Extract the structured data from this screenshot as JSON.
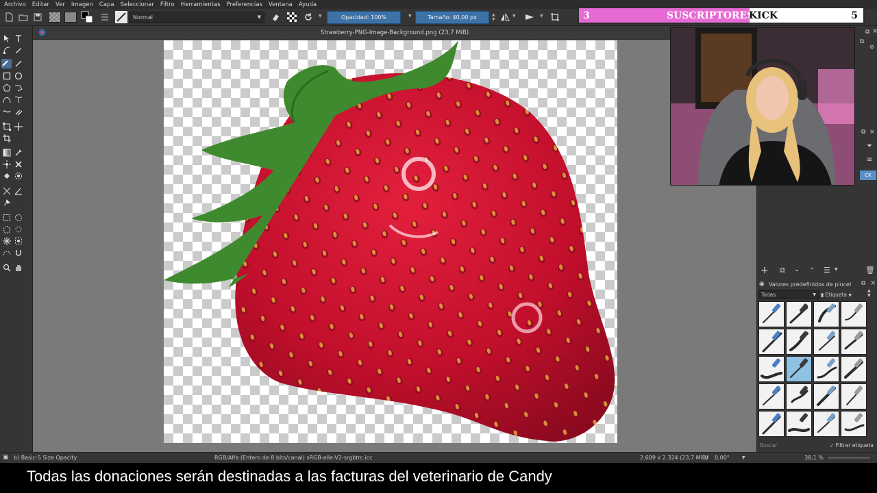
{
  "menu": [
    "Archivo",
    "Editar",
    "Ver",
    "Imagen",
    "Capa",
    "Seleccionar",
    "Filtro",
    "Herramientas",
    "Preferencias",
    "Ventana",
    "Ayuda"
  ],
  "toolbar": {
    "blend_mode": "Normal",
    "opacity_label": "Opacidad: 100%",
    "size_label": "Tamaño: 40,00 px",
    "opacity_value": 1.0
  },
  "sub_banner": {
    "left_count": "3",
    "text_a": "SUSCRIPTORES",
    "text_b": "KICK",
    "right_count": "5",
    "progress": 0.6,
    "fill_color": "#e66ad4"
  },
  "document": {
    "tab_title": "Strawberry-PNG-Image-Background.png (23,7 MiB)"
  },
  "right_panel": {
    "presets_title": "Valores predefinidos de pincel",
    "filter_value": "Todas",
    "tag_label": "Etiqueta",
    "search_placeholder": "Buscar",
    "filter_tag_label": "Filtrar etiqueta",
    "side_badge": "CK"
  },
  "statusbar": {
    "brush_preset": "b) Basic-5 Size Opacity",
    "color_info": "RGB/Alfa (Entero de 8 bits/canal)  sRGB-elle-V2-srgbtrc.icc",
    "dimensions": "2.609 x 2.324 (23,7 MiB)",
    "rotation": "0,00°",
    "zoom": "38,1 %"
  },
  "caption": "Todas las donaciones serán destinadas a las facturas del veterinario de Candy",
  "colors": {
    "panel_bg": "#353535",
    "canvas_bg": "#7a7a7a",
    "accent": "#3d72a8",
    "strawberry": "#c8102e",
    "leaf": "#3f8a2e"
  }
}
